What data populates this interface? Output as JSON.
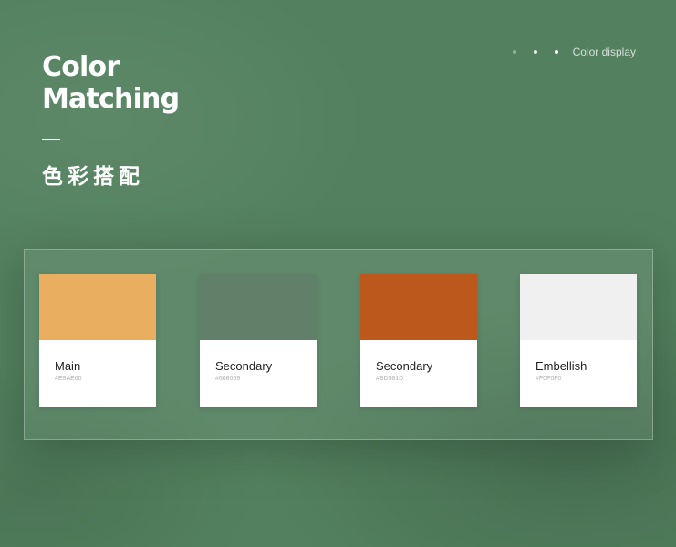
{
  "header": {
    "title_line_1": "Color",
    "title_line_2": "Matching",
    "subtitle_zh": "色彩搭配"
  },
  "nav": {
    "label": "Color display",
    "dot_count": 3,
    "active_dot": 3
  },
  "palette": {
    "items": [
      {
        "name": "Main",
        "hex": "#E9AE60",
        "color": "#E9AE60"
      },
      {
        "name": "Secondary",
        "hex": "#608069",
        "color": "#608069"
      },
      {
        "name": "Secondary",
        "hex": "#BD581D",
        "color": "#BD581D"
      },
      {
        "name": "Embellish",
        "hex": "#F0F0F0",
        "color": "#F0F0F0"
      }
    ]
  },
  "colors": {
    "background": "#53815F",
    "text": "#FFFFFF"
  }
}
